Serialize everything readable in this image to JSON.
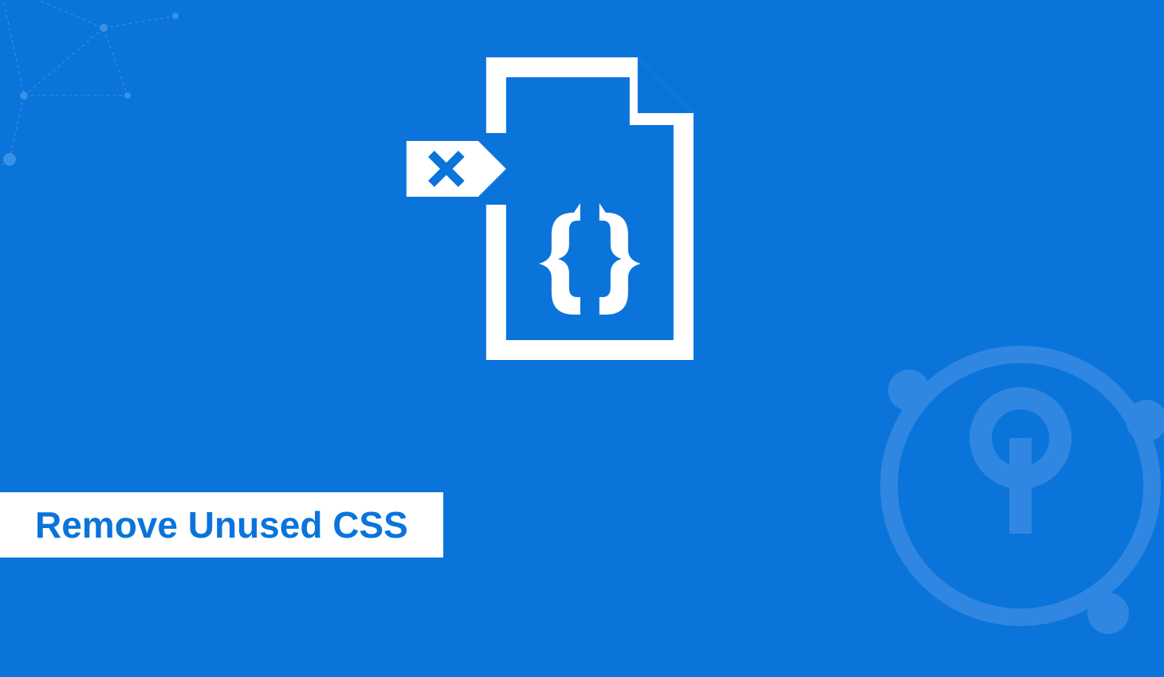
{
  "title": "Remove Unused CSS",
  "colors": {
    "background": "#0a74da",
    "foreground": "#ffffff"
  },
  "icons": {
    "hero": "css-file-remove-icon",
    "bottom_right": "keycdn-logo-icon",
    "top_left": "network-decoration-icon"
  }
}
